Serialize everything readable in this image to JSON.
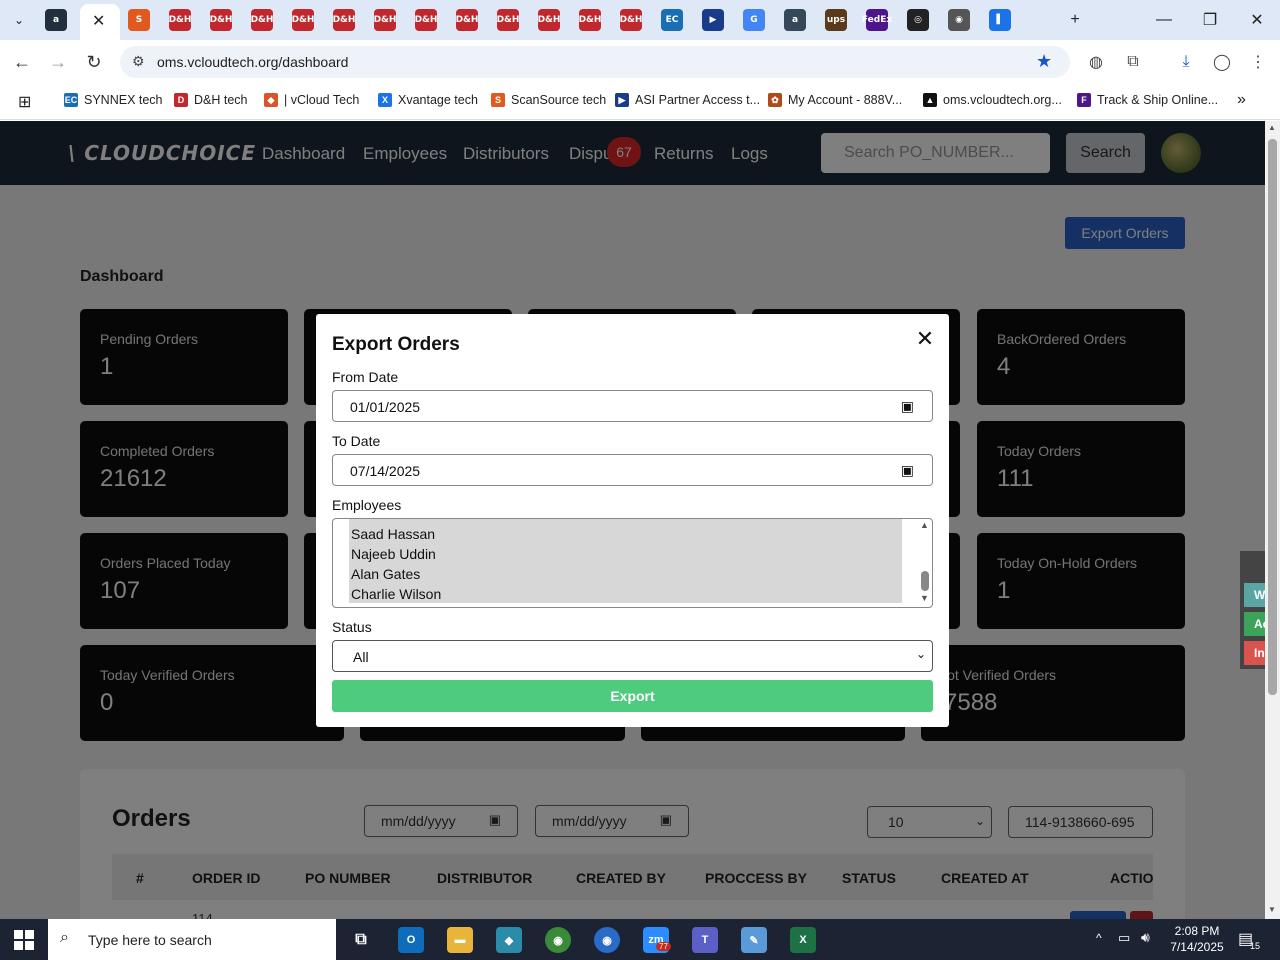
{
  "browser": {
    "url": "oms.vcloudtech.org/dashboard",
    "tab_icons": [
      {
        "name": "amazon-tab-icon",
        "glyph": "a",
        "color": "#232f3e"
      },
      {
        "name": "scansource-tab-icon",
        "glyph": "S",
        "color": "#e05a1f"
      },
      {
        "name": "dh-tab-icon",
        "glyph": "D&H",
        "color": "#c0282e"
      },
      {
        "name": "ec-tab-icon",
        "glyph": "EC",
        "color": "#1a6fb4"
      },
      {
        "name": "asi-tab-icon",
        "glyph": "▶",
        "color": "#1a3a8a"
      },
      {
        "name": "google-tab-icon",
        "glyph": "G",
        "color": "#4285f4"
      },
      {
        "name": "amazon-seller-tab-icon",
        "glyph": "a",
        "color": "#37475a"
      },
      {
        "name": "ups-tab-icon",
        "glyph": "ups",
        "color": "#5a3a1a"
      },
      {
        "name": "fedex-tab-icon",
        "glyph": "FedEx",
        "color": "#4d148c"
      },
      {
        "name": "openai-tab-icon",
        "glyph": "◎",
        "color": "#222"
      },
      {
        "name": "chrome-tab-icon",
        "glyph": "◉",
        "color": "#555"
      },
      {
        "name": "vcloud-tab-icon",
        "glyph": "▌",
        "color": "#1a73e8"
      }
    ],
    "bookmarks": [
      {
        "label": "SYNNEX tech",
        "icon": "EC",
        "color": "#1a6fb4"
      },
      {
        "label": "D&H tech",
        "icon": "D",
        "color": "#c0282e"
      },
      {
        "label": "| vCloud Tech",
        "icon": "◆",
        "color": "#d9532b"
      },
      {
        "label": "Xvantage tech",
        "icon": "X",
        "color": "#1a73e8"
      },
      {
        "label": "ScanSource tech",
        "icon": "S",
        "color": "#e05a1f"
      },
      {
        "label": "ASI Partner Access t...",
        "icon": "▶",
        "color": "#1a3a8a"
      },
      {
        "label": "My Account - 888V...",
        "icon": "✿",
        "color": "#b04a1a"
      },
      {
        "label": "oms.vcloudtech.org...",
        "icon": "▲",
        "color": "#111"
      },
      {
        "label": "Track & Ship Online...",
        "icon": "F",
        "color": "#4d148c"
      }
    ]
  },
  "app": {
    "logo": "\\ CLOUDCHOICE",
    "nav": [
      "Dashboard",
      "Employees",
      "Distributors",
      "Dispu",
      "Returns",
      "Logs"
    ],
    "disputes_badge": "67",
    "search_placeholder": "Search PO_NUMBER...",
    "search_button": "Search",
    "export_orders_button": "Export Orders",
    "dashboard_title": "Dashboard",
    "cards": [
      {
        "label": "Pending Orders",
        "value": "1"
      },
      {
        "label": "BackOrdered Orders",
        "value": "4"
      },
      {
        "label": "Completed Orders",
        "value": "21612"
      },
      {
        "label": "Today Orders",
        "value": "111"
      },
      {
        "label": "Orders Placed Today",
        "value": "107"
      },
      {
        "label": "Today On-Hold Orders",
        "value": "1"
      },
      {
        "label": "Today Verified Orders",
        "value": "0"
      },
      {
        "label": "lot Verified Orders",
        "value": "7588"
      }
    ],
    "orders": {
      "title": "Orders",
      "date_placeholder_1": "mm/dd/yyyy",
      "date_placeholder_2": "mm/dd/yyyy",
      "page_size": "10",
      "search_value": "114-9138660-695",
      "columns": [
        "#",
        "ORDER ID",
        "PO NUMBER",
        "DISTRIBUTOR",
        "CREATED BY",
        "PROCCESS BY",
        "STATUS",
        "CREATED AT",
        "ACTIO"
      ],
      "first_row_id": "114"
    }
  },
  "modal": {
    "title": "Export Orders",
    "from_label": "From Date",
    "from_value": "01/01/2025",
    "to_label": "To Date",
    "to_value": "07/14/2025",
    "employees_label": "Employees",
    "employees": [
      "Saad Hassan",
      "Najeeb Uddin",
      "Alan Gates",
      "Charlie Wilson"
    ],
    "status_label": "Status",
    "status_value": "All",
    "export_button": "Export"
  },
  "side_tabs": [
    {
      "label": "Work",
      "color": "#5ba5a5"
    },
    {
      "label": "Activ",
      "color": "#3ca35a"
    },
    {
      "label": "In Ac",
      "color": "#d9534f"
    }
  ],
  "taskbar": {
    "search_placeholder": "Type here to search",
    "time": "2:08 PM",
    "date": "7/14/2025",
    "notification_count": "15",
    "zoom_badge": "77"
  }
}
